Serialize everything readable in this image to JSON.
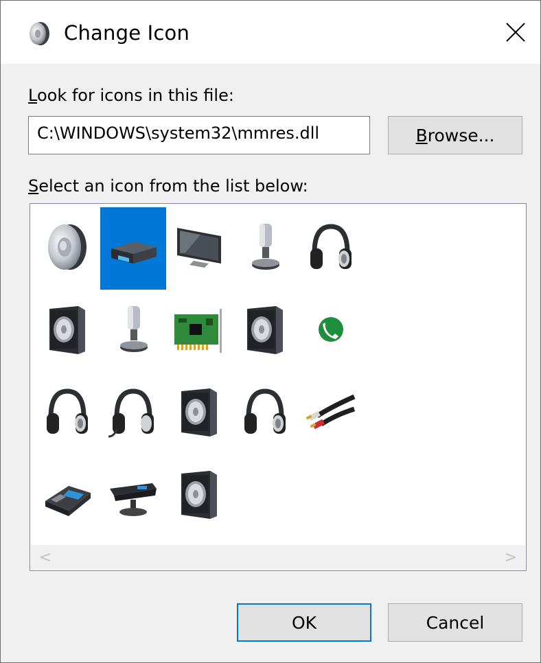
{
  "dialog": {
    "title": "Change Icon",
    "file_label_ul": "L",
    "file_label_rest": "ook for icons in this file:",
    "file_path": "C:\\WINDOWS\\system32\\mmres.dll",
    "browse_ul": "B",
    "browse_rest": "rowse...",
    "list_label_ul": "S",
    "list_label_rest": "elect an icon from the list below:",
    "ok_label": "OK",
    "cancel_label": "Cancel",
    "scroll_left": "<",
    "scroll_right": ">"
  },
  "icons": [
    {
      "name": "speaker-icon",
      "selected": false
    },
    {
      "name": "audio-device-icon",
      "selected": true
    },
    {
      "name": "monitor-icon",
      "selected": false
    },
    {
      "name": "microphone-icon",
      "selected": false
    },
    {
      "name": "headphones-icon",
      "selected": false
    },
    {
      "name": "speaker-box-icon",
      "selected": false
    },
    {
      "name": "microphone-icon",
      "selected": false
    },
    {
      "name": "sound-card-icon",
      "selected": false
    },
    {
      "name": "speaker-box-icon",
      "selected": false
    },
    {
      "name": "phone-call-icon",
      "selected": false
    },
    {
      "name": "headphones-icon",
      "selected": false
    },
    {
      "name": "headset-icon",
      "selected": false
    },
    {
      "name": "speaker-box-icon",
      "selected": false
    },
    {
      "name": "headphones-icon",
      "selected": false
    },
    {
      "name": "rca-cable-icon",
      "selected": false
    },
    {
      "name": "desk-phone-icon",
      "selected": false
    },
    {
      "name": "webcam-icon",
      "selected": false
    },
    {
      "name": "speaker-box-icon",
      "selected": false
    }
  ],
  "colors": {
    "selection": "#0078d7",
    "button_face": "#e1e1e1",
    "dialog_bg": "#f0f0f0"
  }
}
